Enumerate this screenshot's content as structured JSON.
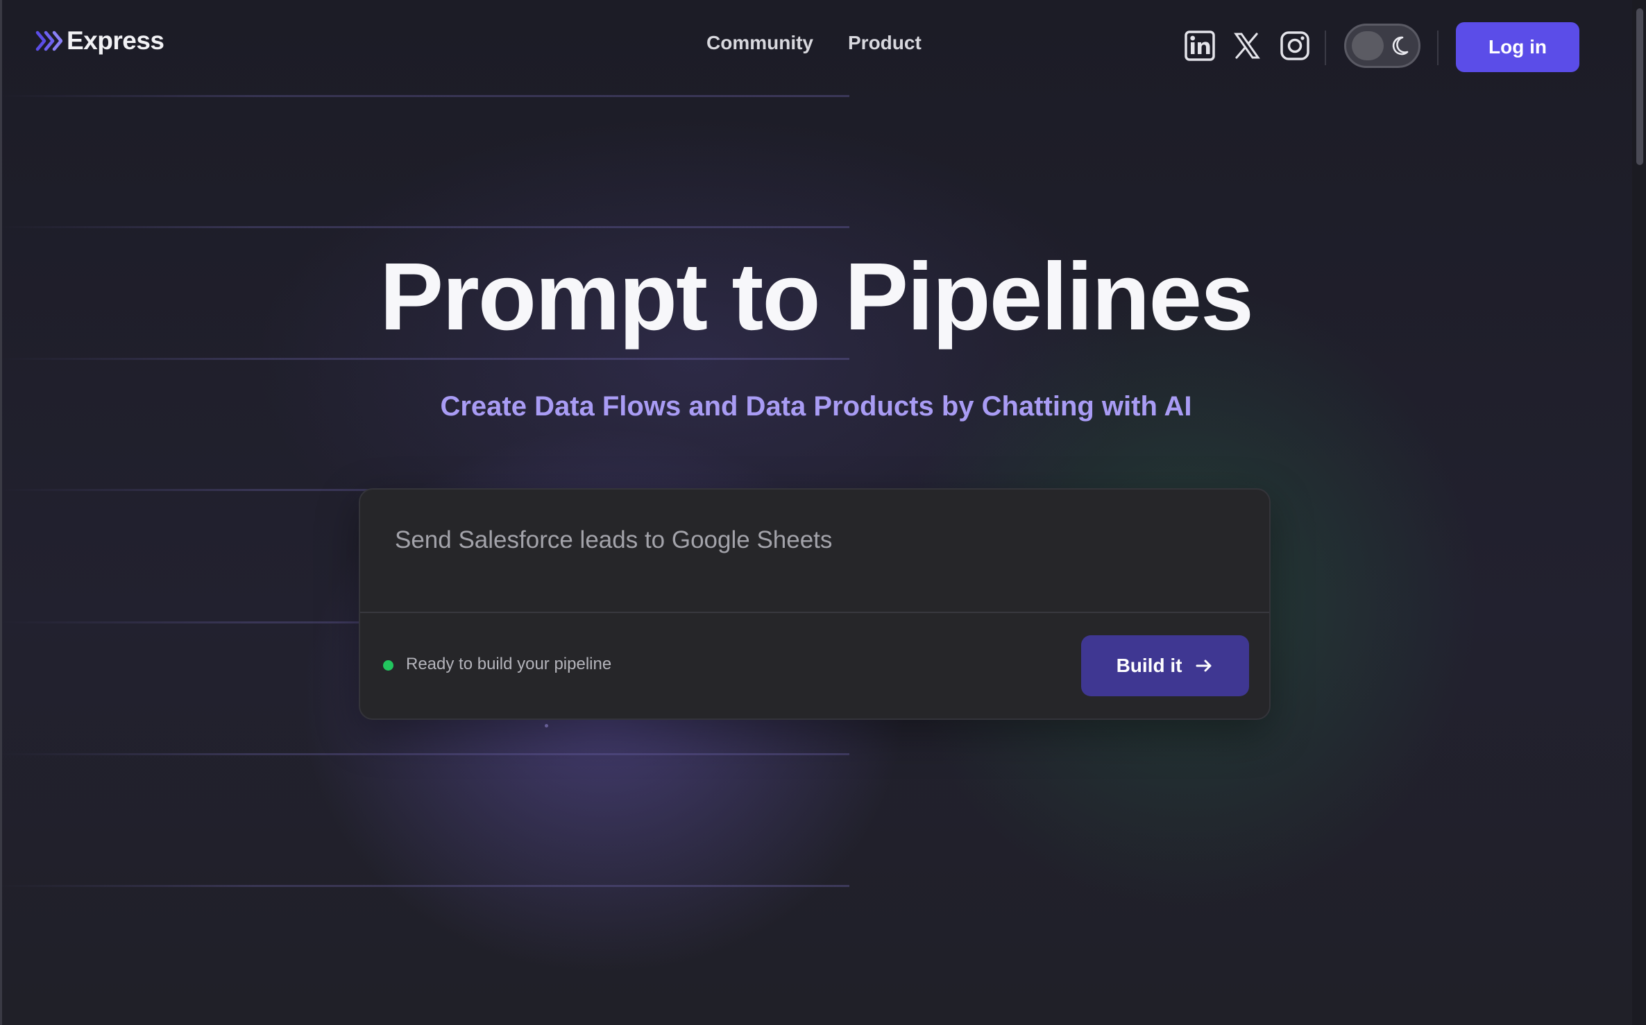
{
  "nav": {
    "logo_text": "Express",
    "links": [
      {
        "label": "Community"
      },
      {
        "label": "Product"
      }
    ],
    "social": [
      "linkedin-icon",
      "x-icon",
      "instagram-icon"
    ],
    "theme_toggle": {
      "mode": "dark",
      "icon": "moon-icon"
    },
    "login_label": "Log in"
  },
  "hero": {
    "title": "Prompt to Pipelines",
    "subtitle": "Create Data Flows and Data Products by Chatting with AI"
  },
  "prompt_card": {
    "input_value": "",
    "placeholder": "Send Salesforce leads to Google Sheets",
    "status_text": "Ready to build your pipeline",
    "build_label": "Build it"
  },
  "colors": {
    "accent": "#5b4de8",
    "subtitle": "#a99cf4",
    "status_ok": "#22c55e",
    "build_button": "#3f3792"
  }
}
